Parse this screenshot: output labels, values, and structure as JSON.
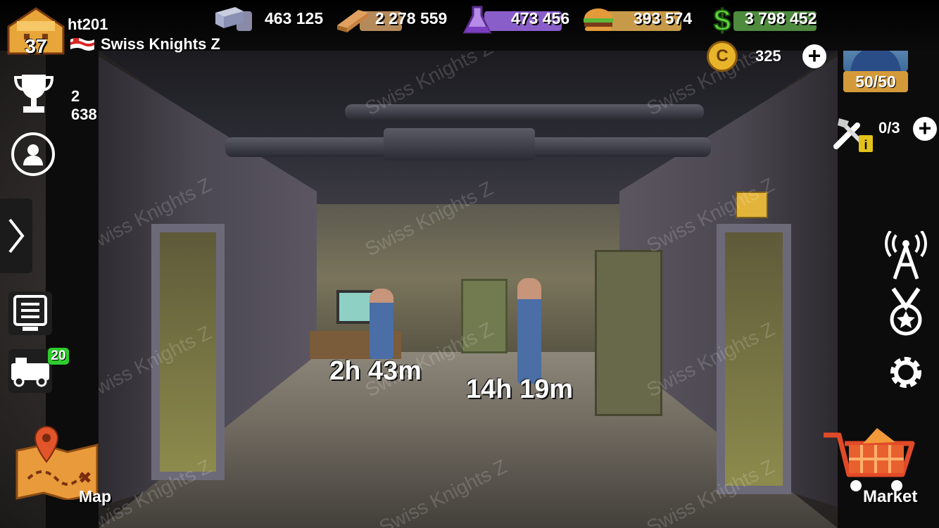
{
  "player": {
    "level": "37",
    "name": "ht201",
    "alliance": "Swiss Knights Z",
    "trophies": "2 638",
    "energy": "50/50"
  },
  "resources": {
    "steel": "463 125",
    "wood": "2 278 559",
    "chemicals": "473 456",
    "food": "393 574",
    "cash": "3 798 452",
    "coins": "325"
  },
  "builders": {
    "count": "0/3"
  },
  "sidebar": {
    "garage_badge": "20",
    "map_label": "Map",
    "market_label": "Market"
  },
  "room": {
    "timers": [
      "2h 43m",
      "14h 19m"
    ]
  },
  "watermark": "Swiss Knights Z",
  "colors": {
    "steel_pill": "#8a8aa8",
    "wood_pill": "#b58a5a",
    "chem_pill": "#8a5ec8",
    "food_pill": "#c79a4a",
    "cash_pill": "#4f8b3f",
    "level_badge": "#e8a53a",
    "energy_bar": "#d49a3a",
    "badge_green": "#2ecc2e"
  }
}
